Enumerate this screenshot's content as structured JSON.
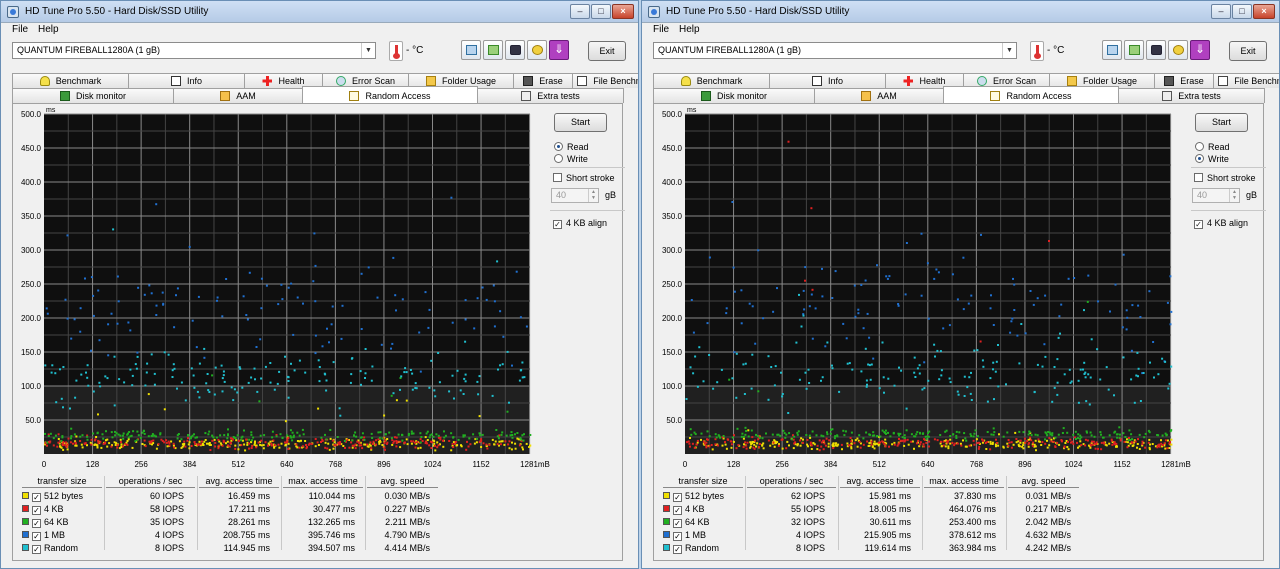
{
  "windows": [
    {
      "id": "L",
      "title": "HD Tune Pro 5.50 - Hard Disk/SSD Utility",
      "menu": [
        "File",
        "Help"
      ],
      "drive": "QUANTUM FIREBALL1280A (1 gB)",
      "temperature": "- °C",
      "exit_label": "Exit",
      "tabs_row1": [
        "Benchmark",
        "Info",
        "Health",
        "Error Scan",
        "Folder Usage",
        "Erase",
        "File Benchmark"
      ],
      "tabs_row2": [
        "Disk monitor",
        "AAM",
        "Random Access",
        "Extra tests"
      ],
      "active_tab": "Random Access",
      "start_label": "Start",
      "mode": "Read",
      "read_label": "Read",
      "write_label": "Write",
      "short_stroke_label": "Short stroke",
      "short_stroke_checked": false,
      "short_stroke_value": "40",
      "short_stroke_unit": "gB",
      "align_label": "4 KB align",
      "align_checked": true,
      "results": {
        "headers": [
          "transfer size",
          "operations / sec",
          "avg. access time",
          "max. access time",
          "avg. speed"
        ],
        "rows": [
          {
            "size": "512 bytes",
            "color": "#f0e000",
            "ops": "60 IOPS",
            "avg": "16.459 ms",
            "max": "110.044 ms",
            "speed": "0.030 MB/s"
          },
          {
            "size": "4 KB",
            "color": "#e02020",
            "ops": "58 IOPS",
            "avg": "17.211 ms",
            "max": "30.477 ms",
            "speed": "0.227 MB/s"
          },
          {
            "size": "64 KB",
            "color": "#20b020",
            "ops": "35 IOPS",
            "avg": "28.261 ms",
            "max": "132.265 ms",
            "speed": "2.211 MB/s"
          },
          {
            "size": "1 MB",
            "color": "#2070d0",
            "ops": "4 IOPS",
            "avg": "208.755 ms",
            "max": "395.746 ms",
            "speed": "4.790 MB/s"
          },
          {
            "size": "Random",
            "color": "#20c0d0",
            "ops": "8 IOPS",
            "avg": "114.945 ms",
            "max": "394.507 ms",
            "speed": "4.414 MB/s"
          }
        ]
      }
    },
    {
      "id": "R",
      "title": "HD Tune Pro 5.50 - Hard Disk/SSD Utility",
      "menu": [
        "File",
        "Help"
      ],
      "drive": "QUANTUM FIREBALL1280A (1 gB)",
      "temperature": "- °C",
      "exit_label": "Exit",
      "tabs_row1": [
        "Benchmark",
        "Info",
        "Health",
        "Error Scan",
        "Folder Usage",
        "Erase",
        "File Benchmark"
      ],
      "tabs_row2": [
        "Disk monitor",
        "AAM",
        "Random Access",
        "Extra tests"
      ],
      "active_tab": "Random Access",
      "start_label": "Start",
      "mode": "Write",
      "read_label": "Read",
      "write_label": "Write",
      "short_stroke_label": "Short stroke",
      "short_stroke_checked": false,
      "short_stroke_value": "40",
      "short_stroke_unit": "gB",
      "align_label": "4 KB align",
      "align_checked": true,
      "results": {
        "headers": [
          "transfer size",
          "operations / sec",
          "avg. access time",
          "max. access time",
          "avg. speed"
        ],
        "rows": [
          {
            "size": "512 bytes",
            "color": "#f0e000",
            "ops": "62 IOPS",
            "avg": "15.981 ms",
            "max": "37.830 ms",
            "speed": "0.031 MB/s"
          },
          {
            "size": "4 KB",
            "color": "#e02020",
            "ops": "55 IOPS",
            "avg": "18.005 ms",
            "max": "464.076 ms",
            "speed": "0.217 MB/s"
          },
          {
            "size": "64 KB",
            "color": "#20b020",
            "ops": "32 IOPS",
            "avg": "30.611 ms",
            "max": "253.400 ms",
            "speed": "2.042 MB/s"
          },
          {
            "size": "1 MB",
            "color": "#2070d0",
            "ops": "4 IOPS",
            "avg": "215.905 ms",
            "max": "378.612 ms",
            "speed": "4.632 MB/s"
          },
          {
            "size": "Random",
            "color": "#20c0d0",
            "ops": "8 IOPS",
            "avg": "119.614 ms",
            "max": "363.984 ms",
            "speed": "4.242 MB/s"
          }
        ]
      }
    }
  ],
  "chart_data": [
    {
      "type": "scatter",
      "title": "",
      "ylabel": "ms",
      "xlabel": "",
      "ylim": [
        0,
        500
      ],
      "xlim": [
        0,
        1281
      ],
      "yticks": [
        "500.0",
        "450.0",
        "400.0",
        "350.0",
        "300.0",
        "250.0",
        "200.0",
        "150.0",
        "100.0",
        "50.0"
      ],
      "xticks": [
        "0",
        "128",
        "256",
        "384",
        "512",
        "640",
        "768",
        "896",
        "1024",
        "1152",
        "1281mB"
      ],
      "grid": true,
      "series": [
        {
          "name": "512 bytes",
          "color": "#f0e000",
          "avg_ms": 16.459,
          "max_ms": 110.044
        },
        {
          "name": "4 KB",
          "color": "#e02020",
          "avg_ms": 17.211,
          "max_ms": 30.477
        },
        {
          "name": "64 KB",
          "color": "#20b020",
          "avg_ms": 28.261,
          "max_ms": 132.265
        },
        {
          "name": "1 MB",
          "color": "#2070d0",
          "avg_ms": 208.755,
          "max_ms": 395.746
        },
        {
          "name": "Random",
          "color": "#20c0d0",
          "avg_ms": 114.945,
          "max_ms": 394.507
        }
      ]
    },
    {
      "type": "scatter",
      "title": "",
      "ylabel": "ms",
      "xlabel": "",
      "ylim": [
        0,
        500
      ],
      "xlim": [
        0,
        1281
      ],
      "yticks": [
        "500.0",
        "450.0",
        "400.0",
        "350.0",
        "300.0",
        "250.0",
        "200.0",
        "150.0",
        "100.0",
        "50.0"
      ],
      "xticks": [
        "0",
        "128",
        "256",
        "384",
        "512",
        "640",
        "768",
        "896",
        "1024",
        "1152",
        "1281mB"
      ],
      "grid": true,
      "series": [
        {
          "name": "512 bytes",
          "color": "#f0e000",
          "avg_ms": 15.981,
          "max_ms": 37.83
        },
        {
          "name": "4 KB",
          "color": "#e02020",
          "avg_ms": 18.005,
          "max_ms": 464.076
        },
        {
          "name": "64 KB",
          "color": "#20b020",
          "avg_ms": 30.611,
          "max_ms": 253.4
        },
        {
          "name": "1 MB",
          "color": "#2070d0",
          "avg_ms": 215.905,
          "max_ms": 378.612
        },
        {
          "name": "Random",
          "color": "#20c0d0",
          "avg_ms": 119.614,
          "max_ms": 363.984
        }
      ]
    }
  ]
}
